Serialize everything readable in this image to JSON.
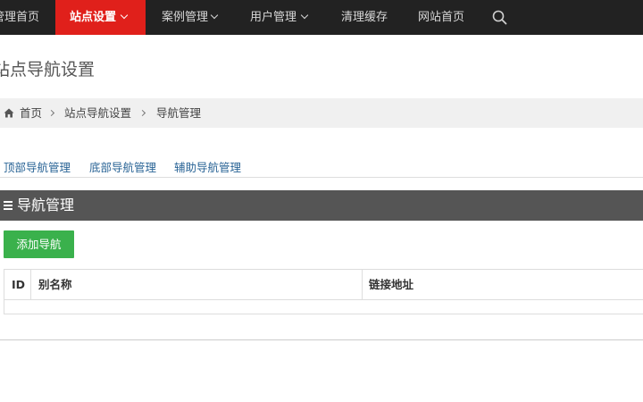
{
  "topnav": {
    "items": [
      {
        "label": "管理首页",
        "has_caret": false
      },
      {
        "label": "站点设置",
        "has_caret": true,
        "active": true
      },
      {
        "label": "案例管理",
        "has_caret": true
      },
      {
        "label": "用户管理",
        "has_caret": true
      },
      {
        "label": "清理缓存",
        "has_caret": false
      },
      {
        "label": "网站首页",
        "has_caret": false
      }
    ],
    "search_icon": "search-icon",
    "active_color": "#e0201b",
    "bar_color": "#222222"
  },
  "page": {
    "title": "站点导航设置"
  },
  "breadcrumb": {
    "home_icon": "home-icon",
    "items": [
      "首页",
      "站点导航设置",
      "导航管理"
    ]
  },
  "subtabs": [
    "顶部导航管理",
    "底部导航管理",
    "辅助导航管理"
  ],
  "panel": {
    "icon": "menu-icon",
    "title": "导航管理",
    "add_button": "添加导航",
    "add_button_color": "#3ab14c"
  },
  "table": {
    "columns": [
      "ID",
      "别名称",
      "链接地址"
    ],
    "rows": []
  }
}
